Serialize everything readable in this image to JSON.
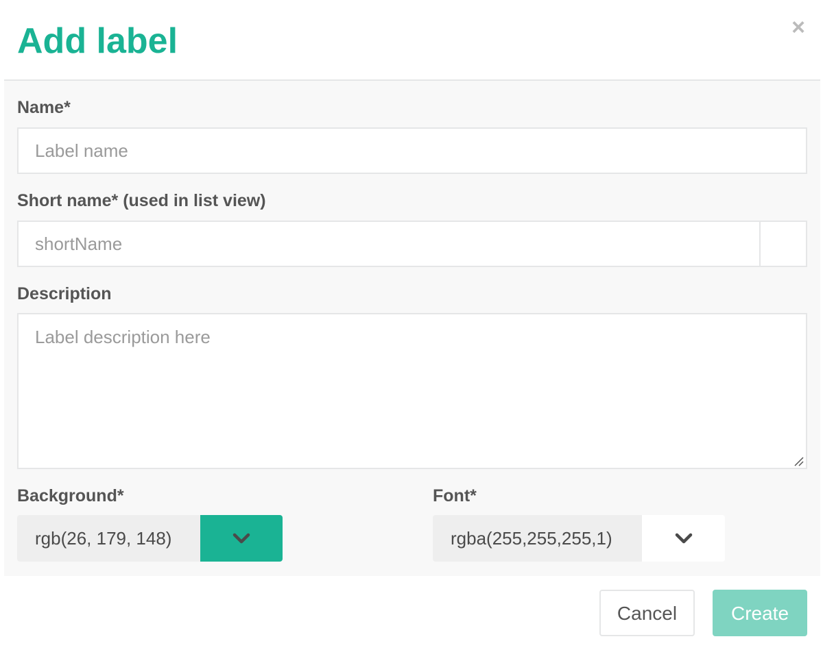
{
  "header": {
    "title": "Add label",
    "close_symbol": "×"
  },
  "form": {
    "name": {
      "label": "Name*",
      "placeholder": "Label name",
      "value": ""
    },
    "short_name": {
      "label": "Short name* (used in list view)",
      "placeholder": "shortName",
      "value": ""
    },
    "description": {
      "label": "Description",
      "placeholder": "Label description here",
      "value": ""
    },
    "background": {
      "label": "Background*",
      "value": "rgb(26, 179, 148)",
      "swatch_color": "#1ab394",
      "icon": "chevron-down-icon"
    },
    "font": {
      "label": "Font*",
      "value": "rgba(255,255,255,1)",
      "swatch_color": "#ffffff",
      "icon": "chevron-down-icon"
    }
  },
  "footer": {
    "cancel_label": "Cancel",
    "create_label": "Create"
  },
  "colors": {
    "accent": "#1ab394",
    "create_button_disabled": "#7fd4c1"
  }
}
